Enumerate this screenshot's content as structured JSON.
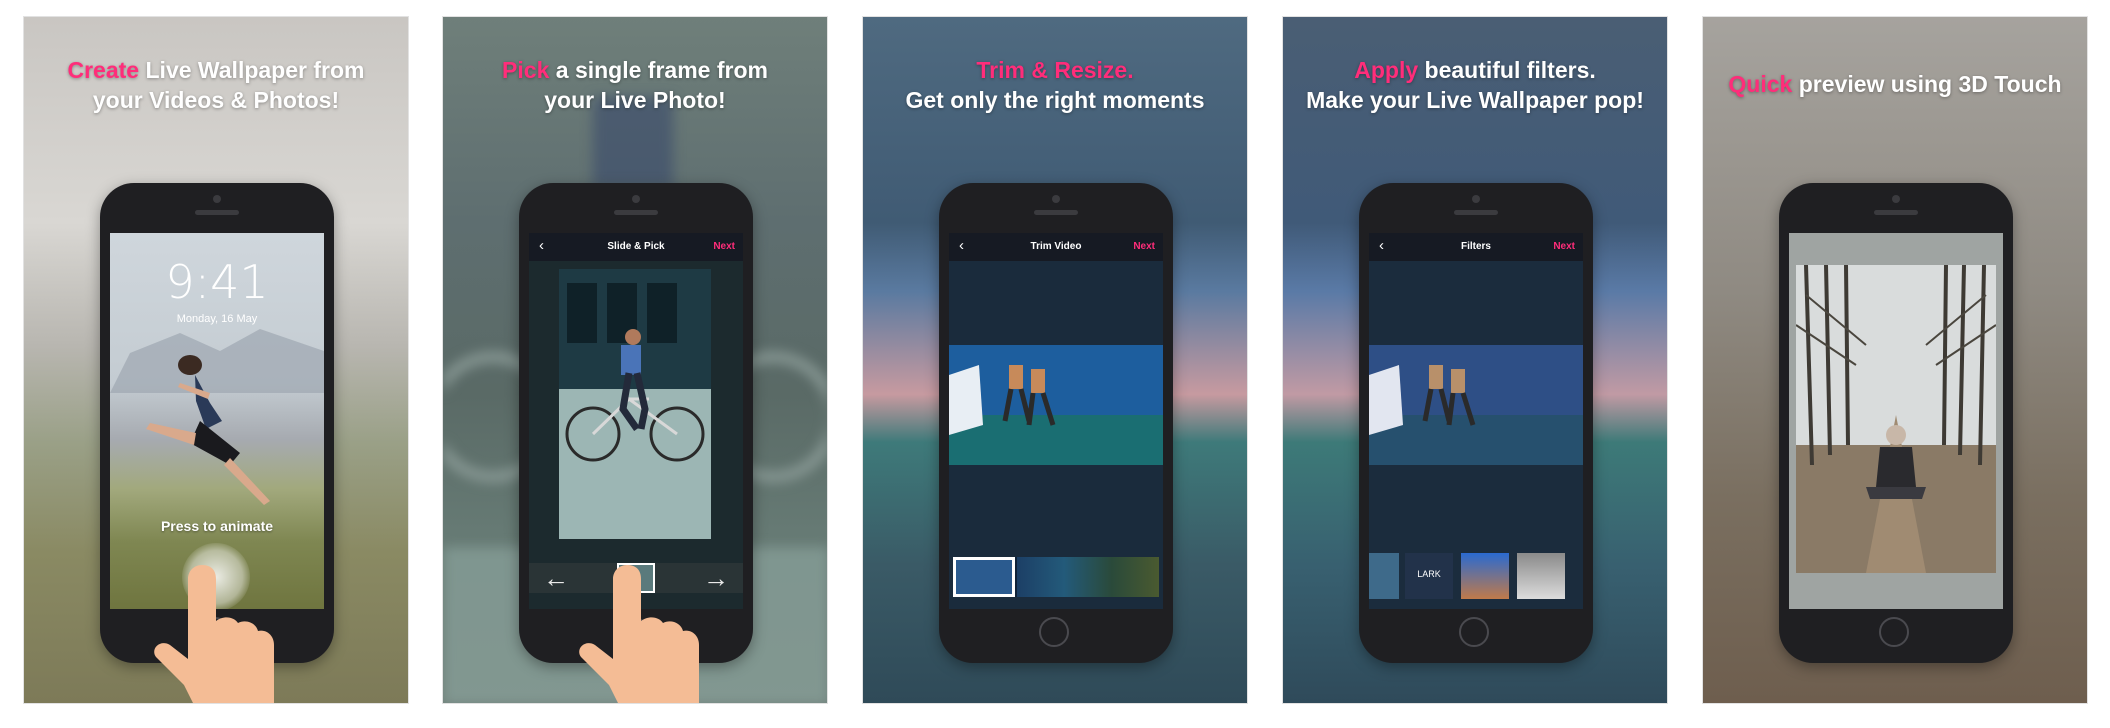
{
  "panels": [
    {
      "headline_highlight": "Create",
      "headline_rest": " Live Wallpaper from",
      "headline_line2": "your Videos & Photos!",
      "lock_time": "9:41",
      "lock_date": "Monday, 16 May",
      "press_label": "Press to animate"
    },
    {
      "headline_highlight": "Pick",
      "headline_rest": " a single frame from",
      "headline_line2": "your Live Photo!",
      "nav_title": "Slide & Pick",
      "nav_next": "Next"
    },
    {
      "headline_highlight": "Trim & Resize.",
      "headline_rest": "",
      "headline_line2": "Get only the right moments",
      "nav_title": "Trim Video",
      "nav_next": "Next"
    },
    {
      "headline_highlight": "Apply",
      "headline_rest": " beautiful filters.",
      "headline_line2": "Make your Live Wallpaper pop!",
      "nav_title": "Filters",
      "nav_next": "Next",
      "filter_label": "LARK"
    },
    {
      "headline_highlight": "Quick",
      "headline_rest": " preview using 3D Touch",
      "headline_line2": ""
    }
  ],
  "colors": {
    "accent": "#ff2d7a",
    "phone": "#1f1f22"
  }
}
